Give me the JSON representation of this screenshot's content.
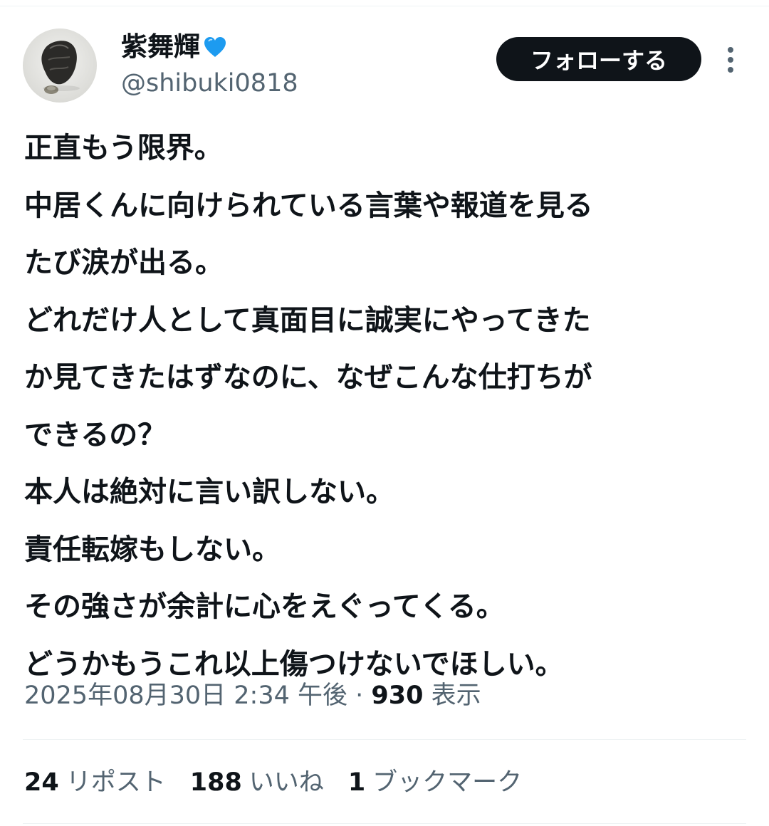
{
  "user": {
    "display_name": "紫舞輝",
    "name_badge_icon": "blue-heart-icon",
    "handle": "@shibuki0818",
    "avatar_icon": "pebble-sketch-avatar"
  },
  "header": {
    "follow_label": "フォローする",
    "more_icon": "more-vertical-icon"
  },
  "tweet": {
    "lines": [
      "正直もう限界。",
      "中居くんに向けられている言葉や報道を見る",
      "たび涙が出る。",
      "どれだけ人として真面目に誠実にやってきた",
      "か見てきたはずなのに、なぜこんな仕打ちが",
      "できるの？",
      "本人は絶対に言い訳しない。",
      "責任転嫁もしない。",
      "その強さが余計に心をえぐってくる。",
      "どうかもうこれ以上傷つけないでほしい。"
    ]
  },
  "meta": {
    "timestamp": "2025年08月30日 2:34 午後",
    "separator": "·",
    "views_count": "930",
    "views_label": "表示"
  },
  "stats": {
    "reposts": {
      "count": "24",
      "label": "リポスト"
    },
    "likes": {
      "count": "188",
      "label": "いいね"
    },
    "bookmarks": {
      "count": "1",
      "label": "ブックマーク"
    }
  },
  "colors": {
    "text_primary": "#0f1419",
    "text_secondary": "#536471",
    "divider": "#eff3f4",
    "follow_bg": "#0f1419",
    "heart": "#1d9bf0"
  }
}
